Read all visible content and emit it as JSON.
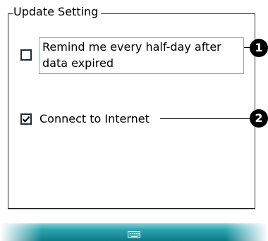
{
  "group": {
    "title": "Update Setting"
  },
  "options": [
    {
      "label": "Remind me every half-day after data expired",
      "checked": false,
      "callout": "1"
    },
    {
      "label": "Connect to Internet",
      "checked": true,
      "callout": "2"
    }
  ],
  "bottombar": {
    "icon": "keyboard-icon"
  },
  "colors": {
    "focus_border": "#5fb8d8",
    "bar_top": "#7fd0d8",
    "bar_bottom": "#0b7a86"
  }
}
